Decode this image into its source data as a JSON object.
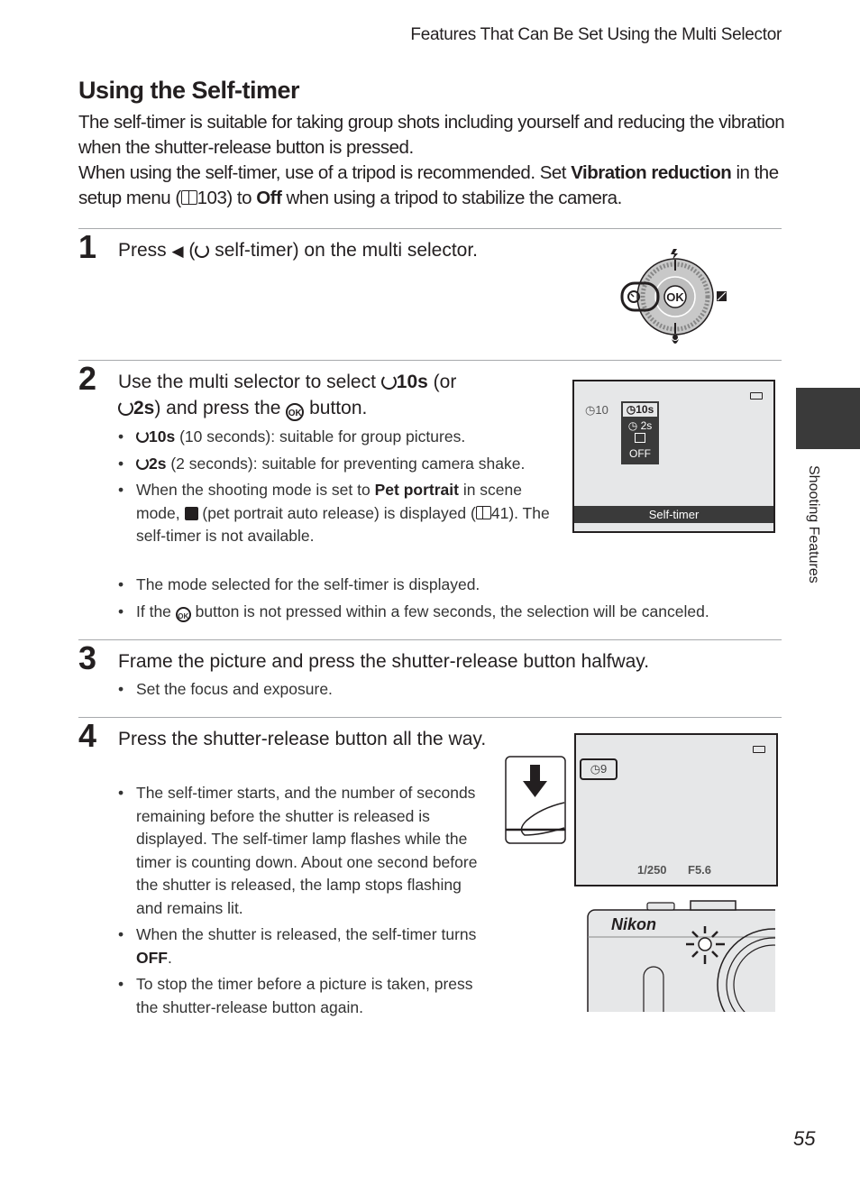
{
  "running_head": "Features That Can Be Set Using the Multi Selector",
  "title": "Using the Self-timer",
  "intro": {
    "p1": "The self-timer is suitable for taking group shots including yourself and reducing the vibration when the shutter-release button is pressed.",
    "p2_a": "When using the self-timer, use of a tripod is recommended. Set ",
    "p2_b": "Vibration reduction",
    "p2_c": " in the setup menu (",
    "p2_ref": "103",
    "p2_d": ") to ",
    "p2_e": "Off",
    "p2_f": " when using a tripod to stabilize the camera."
  },
  "icons": {
    "book": "🕮",
    "timer": "⏲",
    "left_arrow": "◀",
    "ok": "OK"
  },
  "steps": [
    {
      "number": "1",
      "title_a": "Press ",
      "title_b": " (",
      "title_c": " self-timer) on the multi selector.",
      "figure": {
        "center_label": "OK",
        "top_icon": "flash-icon",
        "right_icon": "exposure-compensation-icon",
        "bottom_icon": "macro-icon",
        "left_icon": "self-timer-icon"
      }
    },
    {
      "number": "2",
      "title_a": "Use the multi selector to select ",
      "title_b": "10s",
      "title_c": " (or",
      "title_d": "2s",
      "title_e": ") and press the ",
      "title_f": " button.",
      "bullets": [
        {
          "bold": "10s",
          "text": " (10 seconds): suitable for group pictures."
        },
        {
          "bold": "2s",
          "text": " (2 seconds): suitable for preventing camera shake."
        },
        {
          "text_a": "When the shooting mode is set to ",
          "bold": "Pet portrait",
          "text_b": " in scene mode, ",
          "text_c": " (pet portrait auto release) is displayed (",
          "ref": "41",
          "text_d": "). The self-timer is not available."
        },
        {
          "text": "The mode selected for the self-timer is displayed."
        },
        {
          "text_a": "If the ",
          "text_b": " button is not pressed within a few seconds, the selection will be canceled."
        }
      ],
      "screen": {
        "status_indicator": "10",
        "menu": [
          "10s",
          "2s",
          "pet",
          "OFF"
        ],
        "selected_index": 0,
        "caption": "Self-timer"
      }
    },
    {
      "number": "3",
      "title": "Frame the picture and press the shutter-release button halfway.",
      "bullets": [
        {
          "text": "Set the focus and exposure."
        }
      ]
    },
    {
      "number": "4",
      "title": "Press the shutter-release button all the way.",
      "bullets": [
        {
          "text": "The self-timer starts, and the number of seconds remaining before the shutter is released is displayed. The self-timer lamp flashes while the timer is counting down. About one second before the shutter is released, the lamp stops flashing and remains lit."
        },
        {
          "text_a": "When the shutter is released, the self-timer turns ",
          "bold": "OFF",
          "text_b": "."
        },
        {
          "text": "To stop the timer before a picture is taken, press the shutter-release button again."
        }
      ],
      "screen": {
        "countdown": "9",
        "shutter_speed": "1/250",
        "aperture": "F5.6"
      },
      "camera_brand": "Nikon"
    }
  ],
  "side_tab_label": "Shooting Features",
  "page_number": "55"
}
